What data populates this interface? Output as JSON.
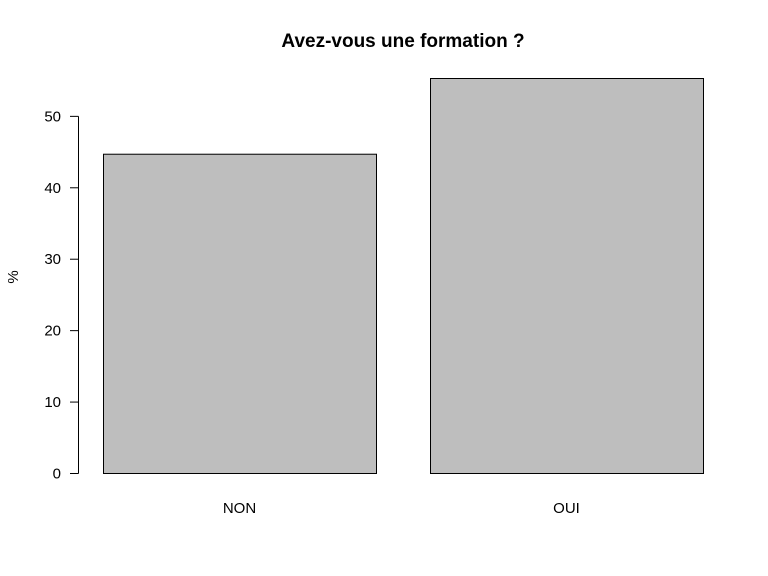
{
  "chart_data": {
    "type": "bar",
    "title": "Avez-vous une formation ?",
    "xlabel": "",
    "ylabel": "%",
    "categories": [
      "NON",
      "OUI"
    ],
    "values": [
      44.7,
      55.3
    ],
    "ylim": [
      0,
      55.3
    ],
    "yticks": [
      0,
      10,
      20,
      30,
      40,
      50
    ],
    "bar_color": "#bebebe",
    "grid": false,
    "legend": "none"
  }
}
